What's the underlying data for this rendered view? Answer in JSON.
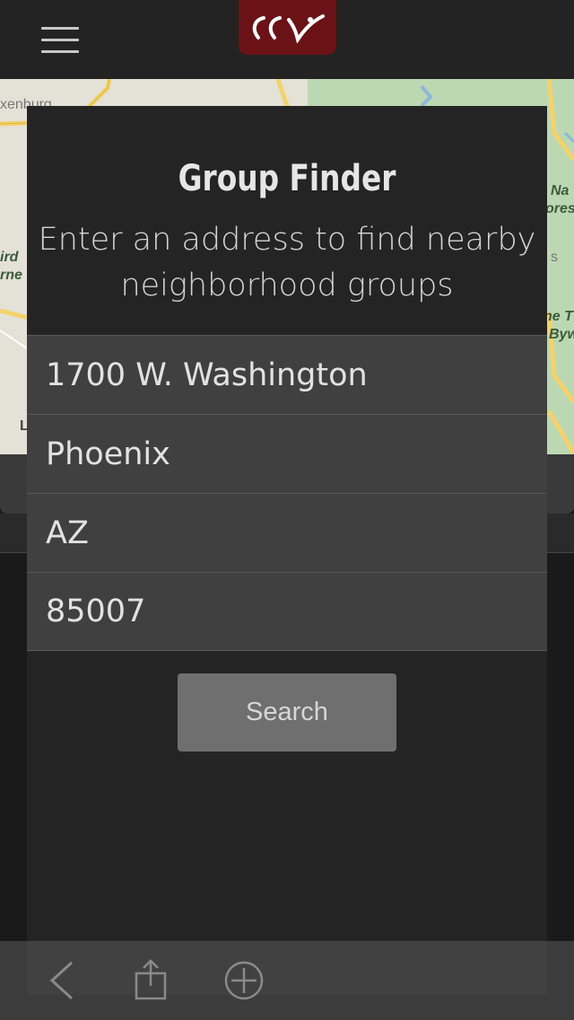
{
  "header": {
    "menu_icon": "hamburger-menu-icon",
    "logo_icon": "ccv-logo-icon",
    "logo_text": "ccv",
    "logo_color": "#6b1216"
  },
  "map": {
    "labels": [
      "xenburg",
      "Na",
      "ores",
      "ird",
      "rne",
      "s",
      "ne T",
      "Byw",
      "L"
    ]
  },
  "modal": {
    "title": "Group Finder",
    "subtitle_line1": "Enter an address to find nearby",
    "subtitle_line2": "neighborhood groups",
    "fields": [
      {
        "name": "street",
        "value": "1700 W. Washington"
      },
      {
        "name": "city",
        "value": "Phoenix"
      },
      {
        "name": "state",
        "value": "AZ"
      },
      {
        "name": "zip",
        "value": "85007"
      }
    ],
    "search_label": "Search"
  },
  "toolbar": {
    "back_icon": "back-chevron-icon",
    "share_icon": "share-icon",
    "add_icon": "add-circle-icon"
  }
}
